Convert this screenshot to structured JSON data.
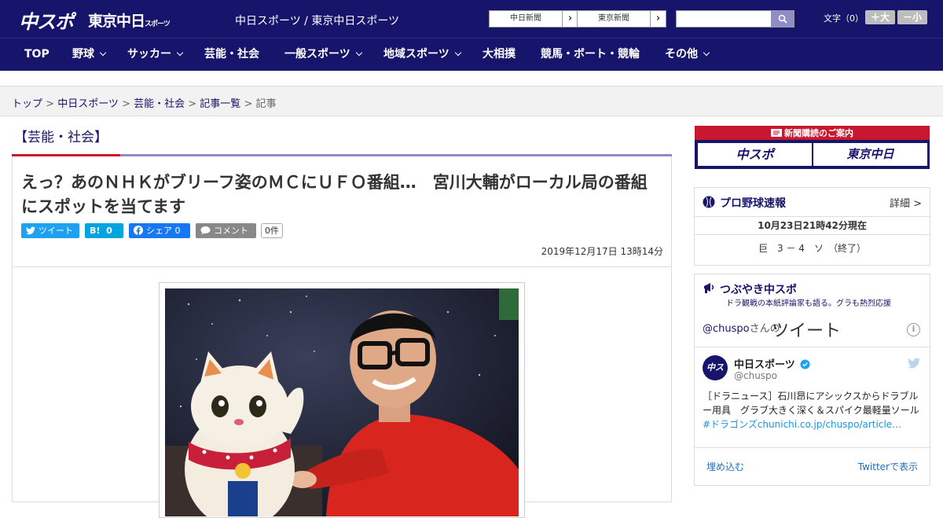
{
  "header": {
    "logo_main": "中スポ",
    "logo_sub": "東京中日",
    "logo_sub_small": "スポーツ",
    "site_name": "中日スポーツ / 東京中日スポーツ",
    "ext_links": [
      "中日新聞",
      "東京新聞"
    ],
    "search_placeholder": "",
    "font_label": "文字（0）",
    "font_bigger": "＋大",
    "font_smaller": "－小"
  },
  "nav": [
    {
      "label": "TOP",
      "dropdown": false
    },
    {
      "label": "野球",
      "dropdown": true
    },
    {
      "label": "サッカー",
      "dropdown": true
    },
    {
      "label": "芸能・社会",
      "dropdown": false
    },
    {
      "label": "一般スポーツ",
      "dropdown": true
    },
    {
      "label": "地域スポーツ",
      "dropdown": true
    },
    {
      "label": "大相撲",
      "dropdown": false
    },
    {
      "label": "競馬・ボート・競輪",
      "dropdown": false
    },
    {
      "label": "その他",
      "dropdown": true
    }
  ],
  "breadcrumb": {
    "items": [
      "トップ",
      "中日スポーツ",
      "芸能・社会",
      "記事一覧"
    ],
    "current": "記事",
    "sep": " > "
  },
  "article": {
    "category": "【芸能・社会】",
    "headline": "えっ？あのＮＨＫがブリーフ姿のＭＣにＵＦＯ番組…　宮川大輔がローカル局の番組にスポットを当てます",
    "share": {
      "tweet": "ツイート",
      "hatena": "0",
      "facebook": "シェア 0",
      "comment": "コメント",
      "comment_count": "0件"
    },
    "date": "2019年12月17日 13時14分"
  },
  "sidebar": {
    "subscribe_title": "新聞購読のご案内",
    "subscribe_buttons": [
      "中スポ",
      "東京中日"
    ],
    "baseball": {
      "title": "プロ野球速報",
      "more": "詳細 >",
      "updated": "10月23日21時42分現在",
      "score": "巨　3 － 4　ソ　（終了）"
    },
    "tweets": {
      "title": "つぶやき中スポ",
      "subtitle": "ドラ観戦の本紙評論家も語る。グラも熱烈応援",
      "handle": "@chuspo",
      "handle_suffix": "さんの",
      "heading": "ツイート",
      "name": "中日スポーツ",
      "id": "@chuspo",
      "text": "［ドラニュース］石川昂にアシックスからドラブルー用具　グラブ大きく深く＆スパイク最軽量ソール",
      "link_text": "#ドラゴンズchunichi.co.jp/chuspo/article…",
      "embed": "埋め込む",
      "view_on_twitter": "Twitterで表示"
    }
  },
  "colors": {
    "navy": "#17146b",
    "red": "#c8172e",
    "lavender": "#8f8cc9",
    "twitter": "#1da1f2",
    "hatena": "#00a4de",
    "facebook": "#1877f2"
  }
}
